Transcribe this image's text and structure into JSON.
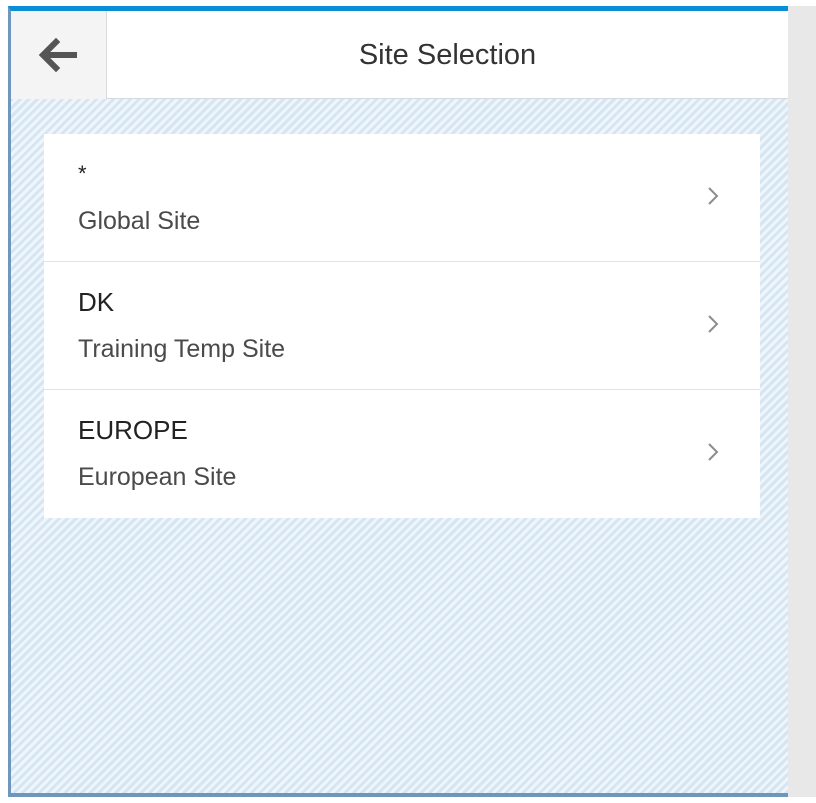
{
  "header": {
    "title": "Site Selection",
    "back_icon": "arrow-left-icon"
  },
  "sites": [
    {
      "code": "*",
      "description": "Global Site",
      "chevron_icon": "chevron-right-icon"
    },
    {
      "code": "DK",
      "description": "Training Temp Site",
      "chevron_icon": "chevron-right-icon"
    },
    {
      "code": "EUROPE",
      "description": "European Site",
      "chevron_icon": "chevron-right-icon"
    }
  ],
  "colors": {
    "accent": "#0a8fd6",
    "background_pattern": "#dceaf5",
    "header_background": "#ffffff",
    "back_button_background": "#f4f4f4",
    "text_primary": "#222222",
    "text_secondary": "#4a4a4a"
  }
}
